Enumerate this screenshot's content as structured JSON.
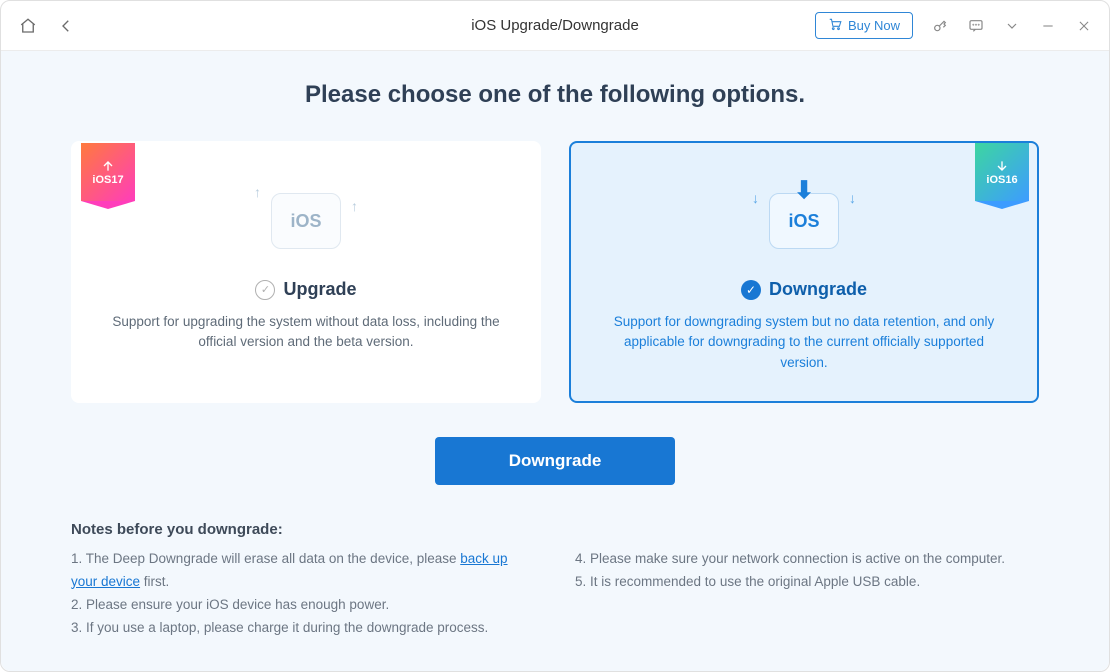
{
  "titlebar": {
    "title": "iOS Upgrade/Downgrade",
    "buy_label": "Buy Now"
  },
  "heading": "Please choose one of the following options.",
  "upgrade_card": {
    "badge_text": "iOS17",
    "ios_label": "iOS",
    "title": "Upgrade",
    "desc": "Support for upgrading the system without data loss, including the official version and the beta version."
  },
  "downgrade_card": {
    "badge_text": "iOS16",
    "ios_label": "iOS",
    "title": "Downgrade",
    "desc": "Support for downgrading system but no data retention, and only applicable for downgrading to the current officially supported version."
  },
  "action_button": "Downgrade",
  "notes": {
    "title": "Notes before you downgrade:",
    "n1_pre": "1.  The Deep Downgrade will erase all data on the device, please ",
    "n1_link": "back up your device",
    "n1_post": " first.",
    "n2": "2.  Please ensure your iOS device has enough power.",
    "n3": "3.  If you use a laptop, please charge it during the downgrade process.",
    "n4": "4.  Please make sure your network connection is active on the computer.",
    "n5": "5.  It is recommended to use the original Apple USB cable."
  }
}
